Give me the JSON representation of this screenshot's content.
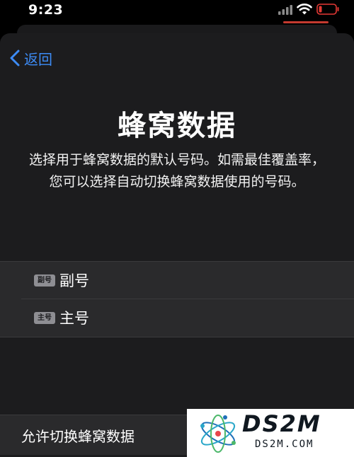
{
  "status_bar": {
    "time": "9:23",
    "battery_color": "#e53935"
  },
  "nav": {
    "back_label": "返回"
  },
  "page": {
    "title": "蜂窝数据",
    "description": "选择用于蜂窝数据的默认号码。如需最佳覆盖率，您可以选择自动切换蜂窝数据使用的号码。"
  },
  "options": [
    {
      "badge": "副号",
      "label": "副号"
    },
    {
      "badge": "主号",
      "label": "主号"
    }
  ],
  "allow_switch": {
    "label": "允许切换蜂窝数据"
  },
  "watermark": {
    "brand": "DS2M",
    "domain": "DS2M.COM"
  },
  "colors": {
    "accent": "#3d8cf6",
    "sheet_bg": "#1c1c1e",
    "row_bg": "#2a2a2c"
  }
}
